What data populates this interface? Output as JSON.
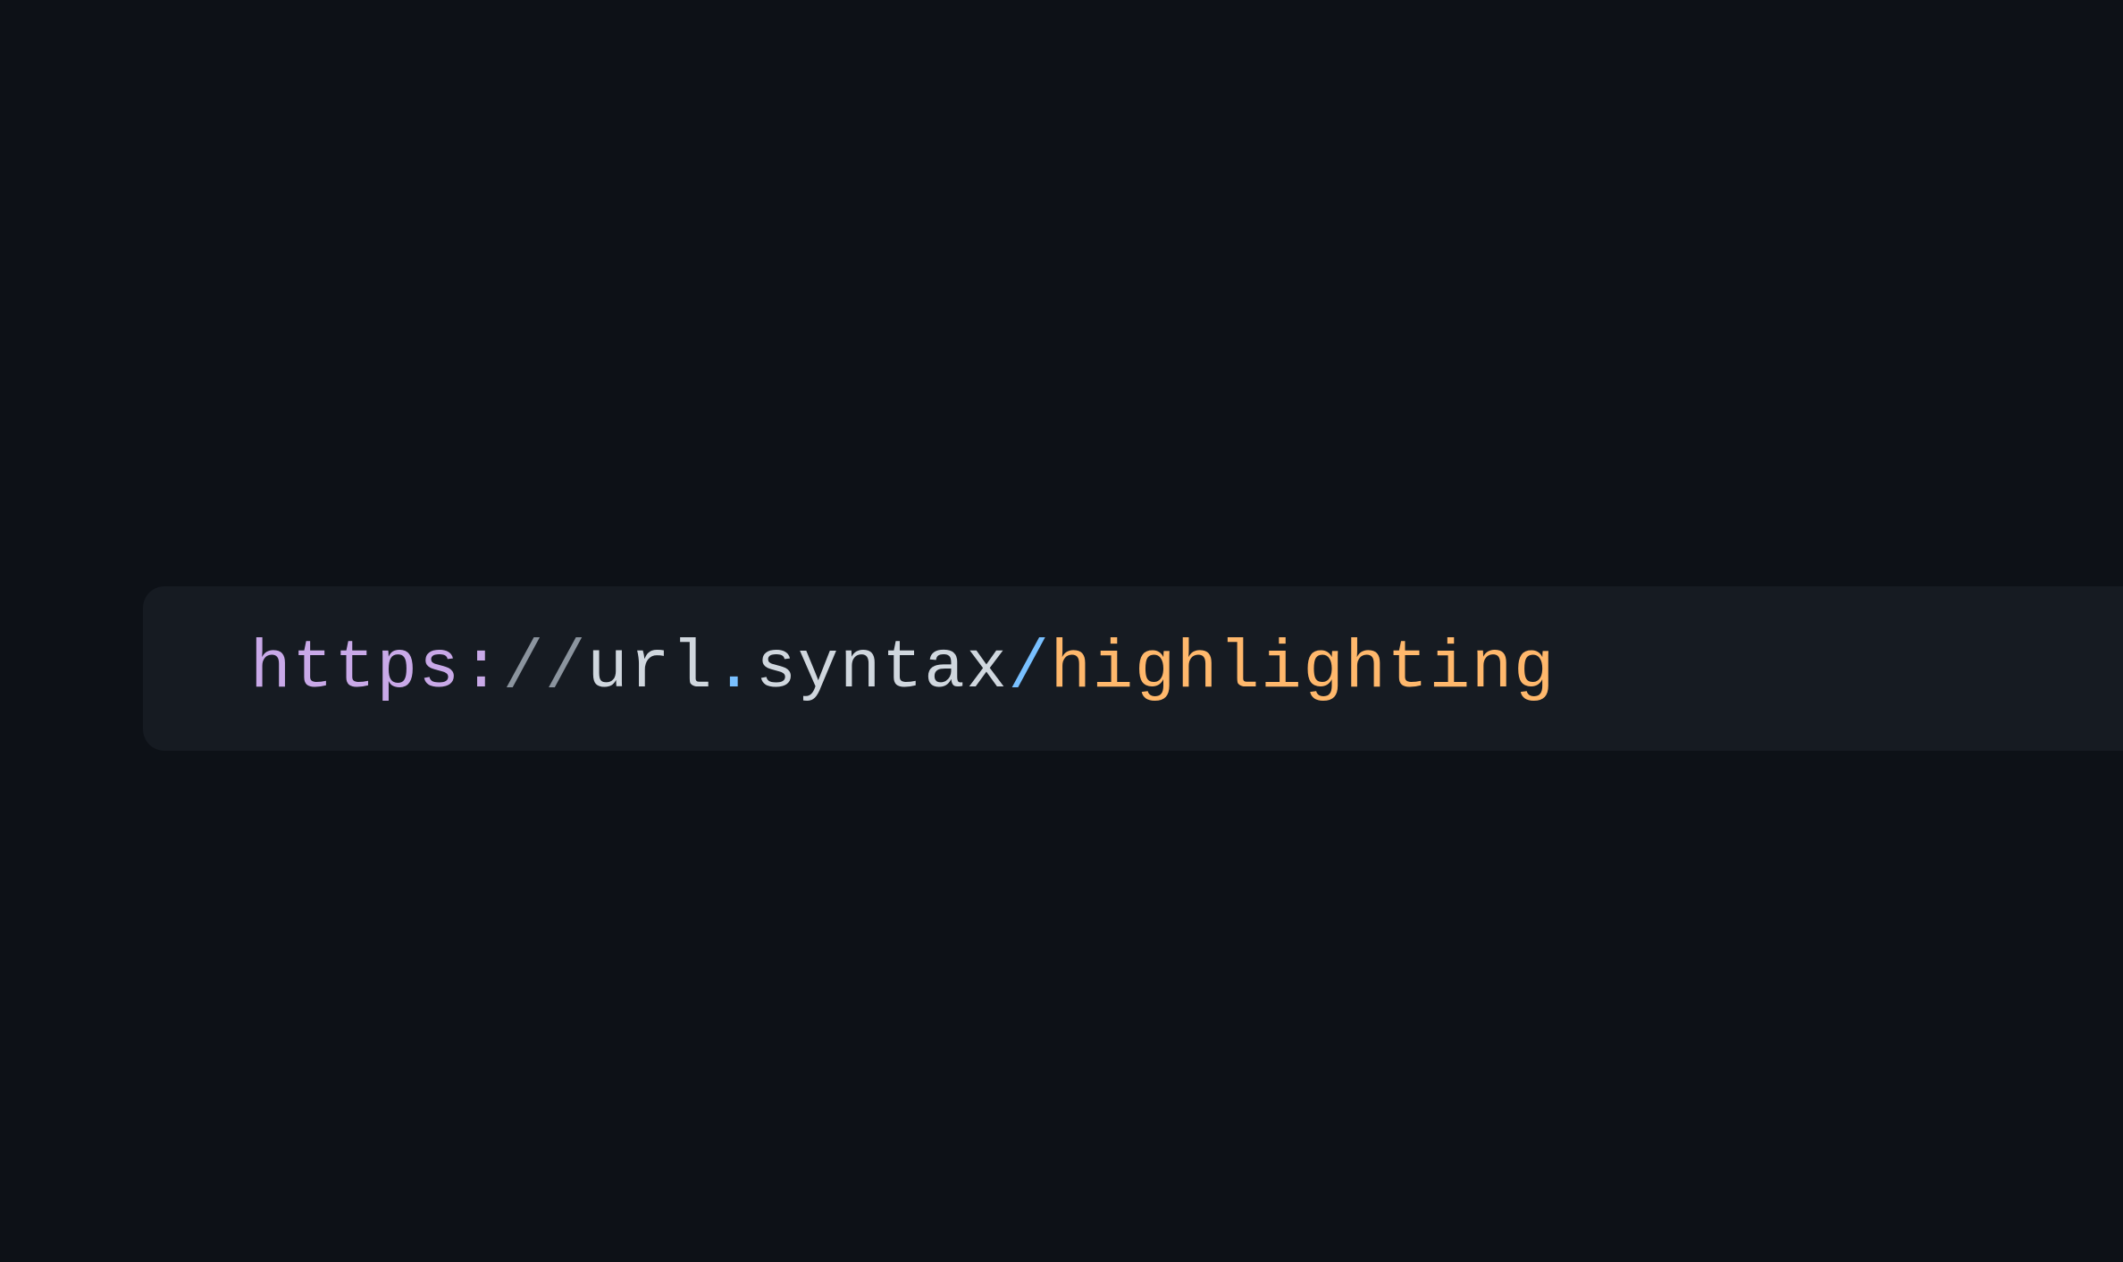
{
  "address_bar": {
    "url_parts": {
      "scheme": "https",
      "colon": ":",
      "slashes": "//",
      "host_sub": "url",
      "dot": ".",
      "host_tld": "syntax",
      "path_slash": "/",
      "path": "highlighting"
    },
    "full_url": "https://url.syntax/highlighting"
  },
  "colors": {
    "background": "#0d1117",
    "bar_background": "#161b22",
    "scheme": "#c9a9e8",
    "slashes": "#8b949e",
    "host": "#d0d7de",
    "dot": "#79c0ff",
    "path_slash": "#79c0ff",
    "path": "#ffb86c"
  }
}
